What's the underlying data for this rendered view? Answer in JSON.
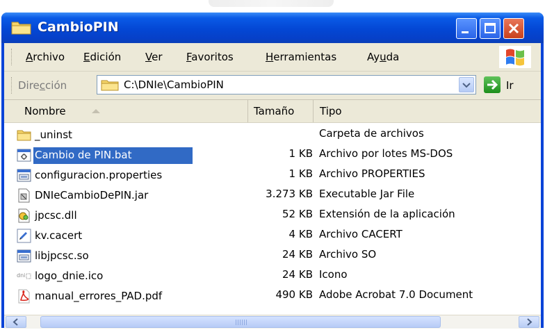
{
  "window": {
    "title": "CambioPIN",
    "buttons": {
      "minimize": "minimize",
      "maximize": "maximize",
      "close": "close"
    }
  },
  "menubar": {
    "items": [
      {
        "label": "Archivo",
        "accel_index": 0
      },
      {
        "label": "Edición",
        "accel_index": 0
      },
      {
        "label": "Ver",
        "accel_index": 0
      },
      {
        "label": "Favoritos",
        "accel_index": 0
      },
      {
        "label": "Herramientas",
        "accel_index": 0
      },
      {
        "label": "Ayuda",
        "accel_index": 2
      }
    ]
  },
  "addressbar": {
    "label": "Dirección",
    "path": "C:\\DNIe\\CambioPIN",
    "go_label": "Ir"
  },
  "columns": {
    "name": "Nombre",
    "size": "Tamaño",
    "type": "Tipo"
  },
  "files": [
    {
      "name": "_uninst",
      "size": "",
      "type": "Carpeta de archivos",
      "icon": "folder-icon",
      "selected": false
    },
    {
      "name": "Cambio de PIN.bat",
      "size": "1 KB",
      "type": "Archivo por lotes MS-DOS",
      "icon": "batch-file-icon",
      "selected": true
    },
    {
      "name": "configuracion.properties",
      "size": "1 KB",
      "type": "Archivo PROPERTIES",
      "icon": "generic-file-icon",
      "selected": false
    },
    {
      "name": "DNIeCambioDePIN.jar",
      "size": "3.273 KB",
      "type": "Executable Jar File",
      "icon": "jar-file-icon",
      "selected": false
    },
    {
      "name": "jpcsc.dll",
      "size": "52 KB",
      "type": "Extensión de la aplicación",
      "icon": "dll-file-icon",
      "selected": false
    },
    {
      "name": "kv.cacert",
      "size": "4 KB",
      "type": "Archivo CACERT",
      "icon": "certificate-file-icon",
      "selected": false
    },
    {
      "name": "libjpcsc.so",
      "size": "24 KB",
      "type": "Archivo SO",
      "icon": "generic-file-icon",
      "selected": false
    },
    {
      "name": "logo_dnie.ico",
      "size": "24 KB",
      "type": "Icono",
      "icon": "ico-file-icon",
      "selected": false
    },
    {
      "name": "manual_errores_PAD.pdf",
      "size": "490 KB",
      "type": "Adobe Acrobat 7.0 Document",
      "icon": "pdf-file-icon",
      "selected": false
    }
  ],
  "colors": {
    "title_bar": "#0A5AE6",
    "selection": "#316AC5",
    "chrome": "#ECE9D8"
  }
}
